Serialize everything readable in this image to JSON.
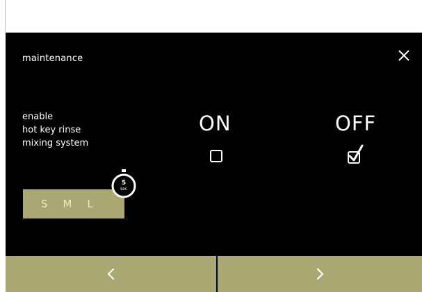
{
  "header": {
    "title": "maintenance",
    "close_icon": "close-icon"
  },
  "setting": {
    "label_lines": [
      "enable",
      "hot key rinse",
      "mixing system"
    ]
  },
  "options": [
    {
      "label": "ON",
      "checked": false
    },
    {
      "label": "OFF",
      "checked": true
    }
  ],
  "sizes": {
    "items": [
      "S",
      "M",
      "L"
    ],
    "timer_value": "5",
    "timer_unit": "sec"
  },
  "navigation": {
    "prev_icon": "chevron-left-icon",
    "next_icon": "chevron-right-icon"
  },
  "colors": {
    "background": "#000000",
    "accent": "#a9a873",
    "text": "#ffffff"
  }
}
